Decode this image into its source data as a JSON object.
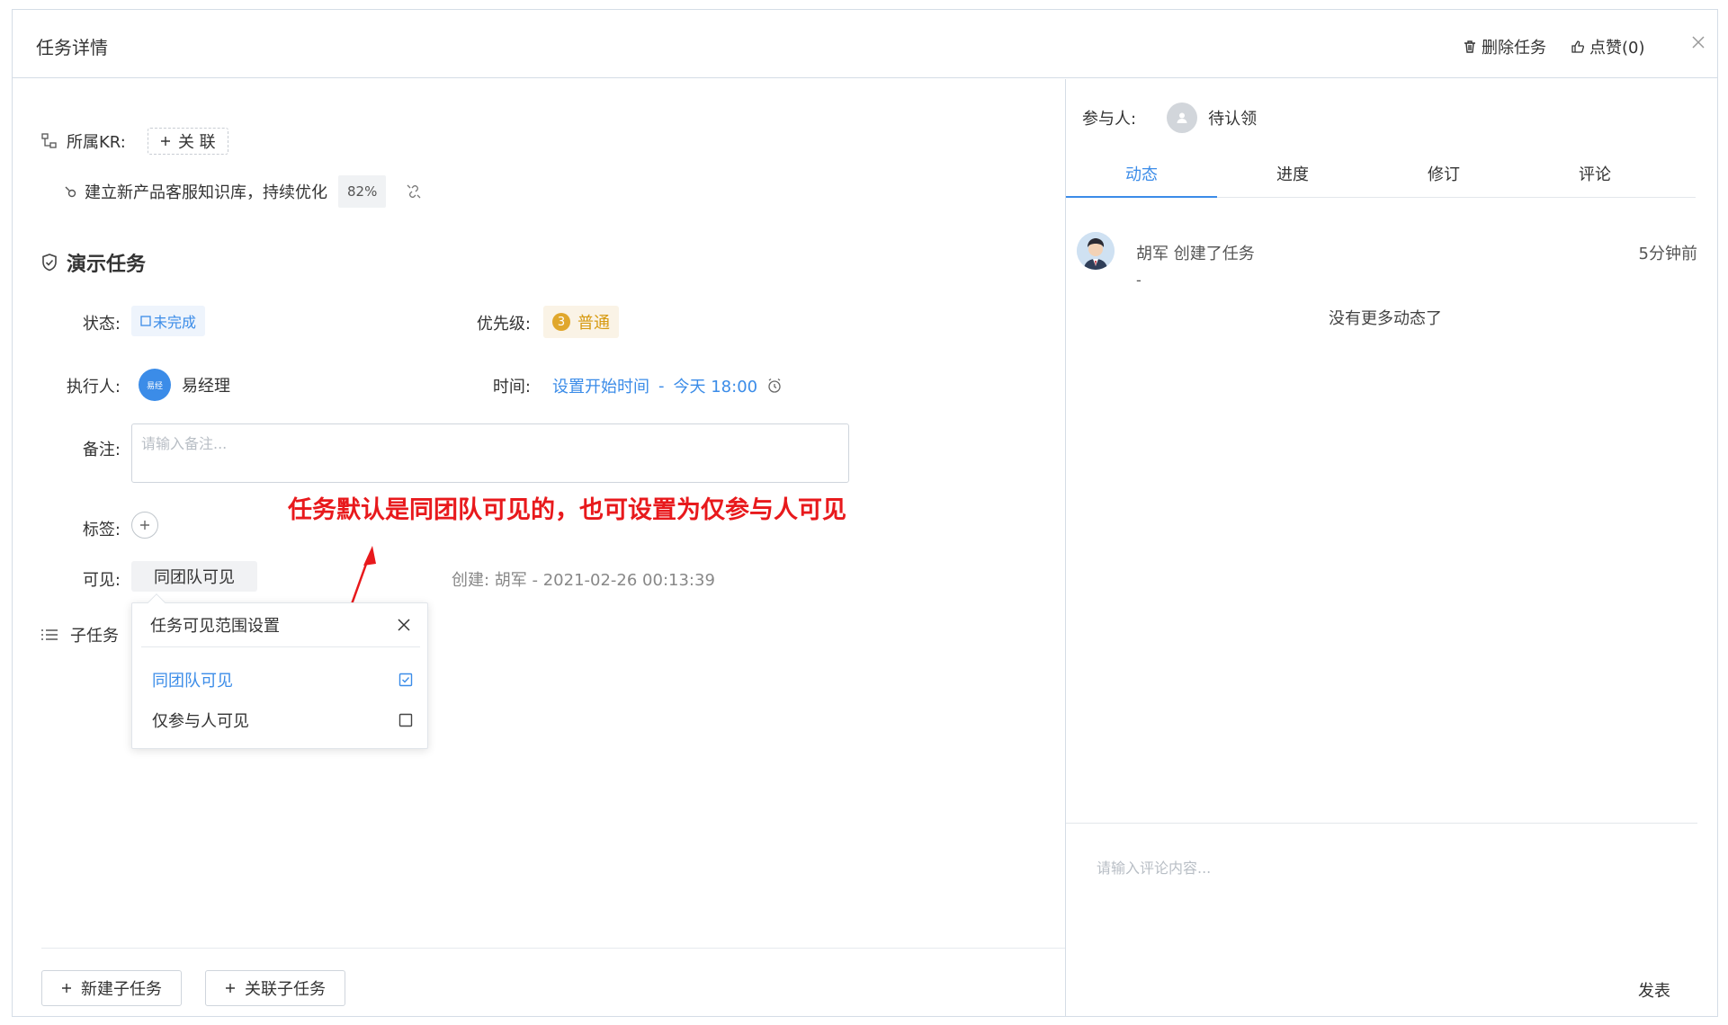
{
  "header": {
    "title": "任务详情",
    "delete_label": "删除任务",
    "like_label": "点赞(0)"
  },
  "kr": {
    "label": "所属KR:",
    "link_label": "关 联",
    "item_text": "建立新产品客服知识库，持续优化",
    "item_progress": "82%"
  },
  "task": {
    "title": "演示任务",
    "status_label": "状态:",
    "status_value": "未完成",
    "priority_label": "优先级:",
    "priority_num": "3",
    "priority_value": "普通",
    "assignee_label": "执行人:",
    "assignee_avatar_text": "易经",
    "assignee_name": "易经理",
    "time_label": "时间:",
    "time_start": "设置开始时间",
    "time_sep": "-",
    "time_end": "今天 18:00",
    "note_label": "备注:",
    "note_placeholder": "请输入备注...",
    "tag_label": "标签:",
    "visible_label": "可见:",
    "visible_value": "同团队可见",
    "created_text": "创建:  胡军 - 2021-02-26 00:13:39",
    "subtask_label": "子任务"
  },
  "annotation": "任务默认是同团队可见的，也可设置为仅参与人可见",
  "popup": {
    "title": "任务可见范围设置",
    "options": [
      {
        "label": "同团队可见",
        "checked": true
      },
      {
        "label": "仅参与人可见",
        "checked": false
      }
    ]
  },
  "bottom": {
    "new_subtask": "新建子任务",
    "link_subtask": "关联子任务"
  },
  "right": {
    "participants_label": "参与人:",
    "participant_name": "待认领",
    "tabs": [
      "动态",
      "进度",
      "修订",
      "评论"
    ],
    "activity": {
      "text": "胡军 创建了任务",
      "time": "5分钟前",
      "detail": "-"
    },
    "no_more": "没有更多动态了",
    "comment_placeholder": "请输入评论内容...",
    "publish": "发表"
  },
  "colors": {
    "accent": "#3b8ce8",
    "annotation": "#e8191c",
    "priority": "#d79a10"
  }
}
